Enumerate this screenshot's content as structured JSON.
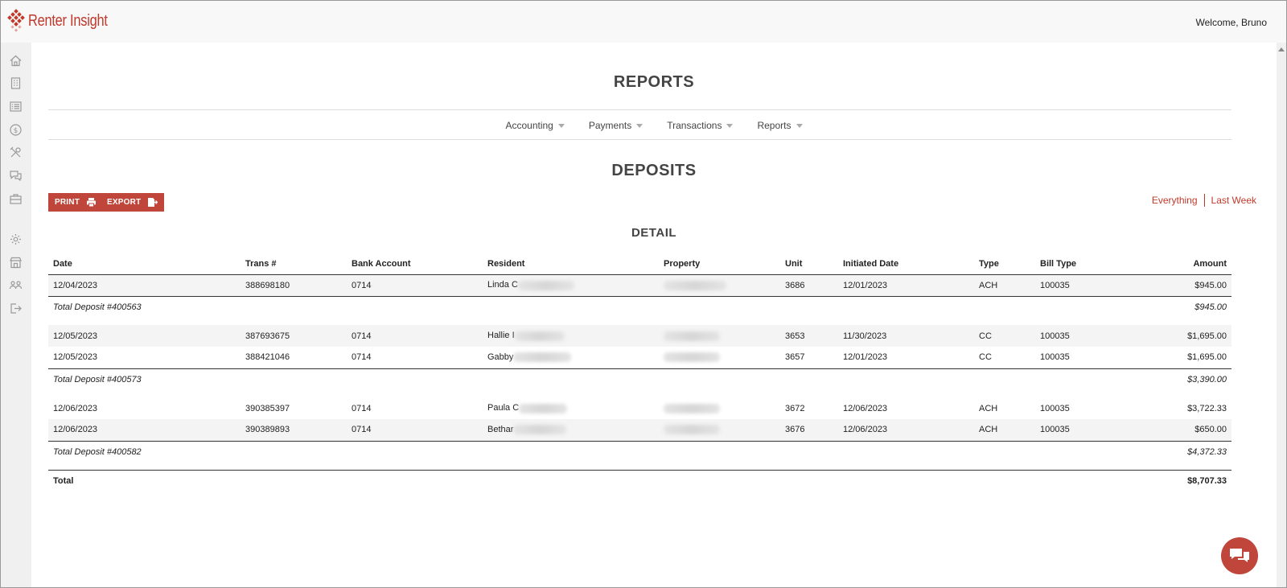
{
  "app": {
    "name": "Renter Insight",
    "welcome": "Welcome, Bruno",
    "brand_color": "#c0392b"
  },
  "sidebar": {
    "icons": [
      "home-icon",
      "building-icon",
      "list-icon",
      "dollar-icon",
      "tools-icon",
      "chat-icon",
      "briefcase-icon",
      "gear-icon",
      "store-icon",
      "users-icon",
      "logout-icon"
    ],
    "help": "?"
  },
  "page": {
    "title": "REPORTS"
  },
  "subnav": [
    {
      "label": "Accounting"
    },
    {
      "label": "Payments"
    },
    {
      "label": "Transactions"
    },
    {
      "label": "Reports"
    }
  ],
  "report": {
    "title": "DEPOSITS",
    "print_label": "PRINT",
    "export_label": "EXPORT",
    "filters": [
      "Everything",
      "Last Week"
    ],
    "detail_title": "DETAIL"
  },
  "table": {
    "headers": [
      "Date",
      "Trans #",
      "Bank Account",
      "Resident",
      "Property",
      "Unit",
      "Initiated Date",
      "Type",
      "Bill Type",
      "Amount"
    ],
    "groups": [
      {
        "rows": [
          {
            "date": "12/04/2023",
            "trans": "388698180",
            "bank": "0714",
            "resident": "Linda C",
            "unit": "3686",
            "initiated": "12/01/2023",
            "type": "ACH",
            "bill_type": "100035",
            "amount": "$945.00"
          }
        ],
        "subtotal_label": "Total Deposit #400563",
        "subtotal": "$945.00"
      },
      {
        "rows": [
          {
            "date": "12/05/2023",
            "trans": "387693675",
            "bank": "0714",
            "resident": "Hallie I",
            "unit": "3653",
            "initiated": "11/30/2023",
            "type": "CC",
            "bill_type": "100035",
            "amount": "$1,695.00"
          },
          {
            "date": "12/05/2023",
            "trans": "388421046",
            "bank": "0714",
            "resident": "Gabby",
            "unit": "3657",
            "initiated": "12/01/2023",
            "type": "CC",
            "bill_type": "100035",
            "amount": "$1,695.00"
          }
        ],
        "subtotal_label": "Total Deposit #400573",
        "subtotal": "$3,390.00"
      },
      {
        "rows": [
          {
            "date": "12/06/2023",
            "trans": "390385397",
            "bank": "0714",
            "resident": "Paula C",
            "unit": "3672",
            "initiated": "12/06/2023",
            "type": "ACH",
            "bill_type": "100035",
            "amount": "$3,722.33"
          },
          {
            "date": "12/06/2023",
            "trans": "390389893",
            "bank": "0714",
            "resident": "Bethar",
            "unit": "3676",
            "initiated": "12/06/2023",
            "type": "ACH",
            "bill_type": "100035",
            "amount": "$650.00"
          }
        ],
        "subtotal_label": "Total Deposit #400582",
        "subtotal": "$4,372.33"
      }
    ],
    "total_label": "Total",
    "total": "$8,707.33"
  }
}
